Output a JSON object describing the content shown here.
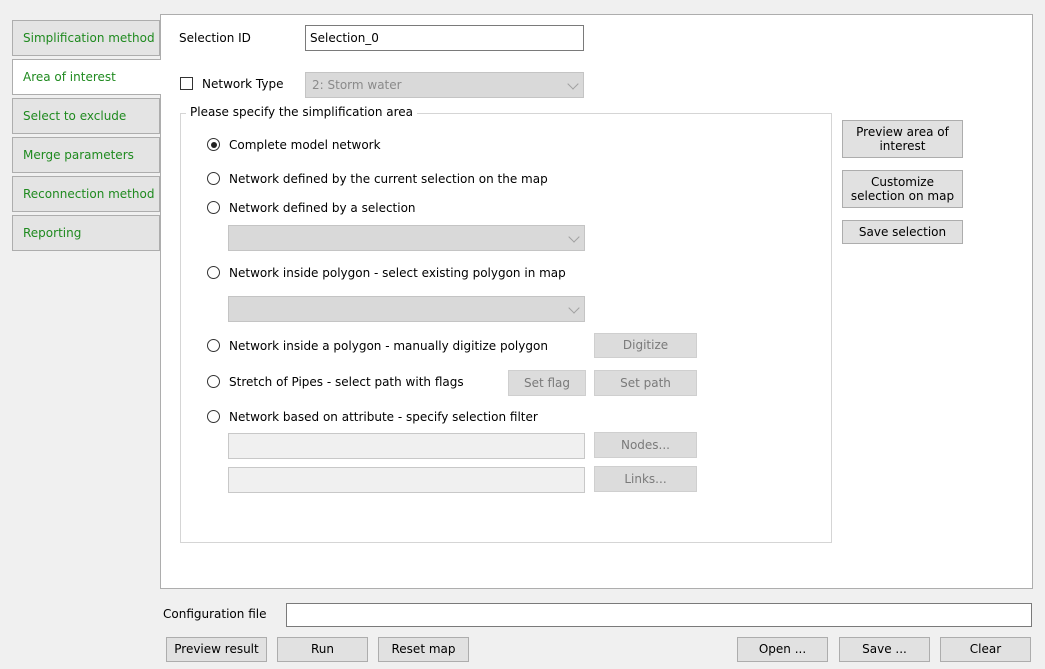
{
  "tabs": [
    {
      "label": "Simplification method",
      "active": false
    },
    {
      "label": "Area of interest",
      "active": true
    },
    {
      "label": "Select to exclude",
      "active": false
    },
    {
      "label": "Merge parameters",
      "active": false
    },
    {
      "label": "Reconnection method",
      "active": false
    },
    {
      "label": "Reporting",
      "active": false
    }
  ],
  "selection_id": {
    "label": "Selection ID",
    "value": "Selection_0"
  },
  "network_type": {
    "label": "Network Type",
    "checked": false,
    "value": "2: Storm water"
  },
  "group_title": "Please specify the simplification area",
  "options": [
    {
      "label": "Complete model network",
      "selected": true
    },
    {
      "label": "Network defined by the current selection on the map",
      "selected": false
    },
    {
      "label": "Network defined by a selection",
      "selected": false
    },
    {
      "label": "Network inside polygon - select existing polygon in map",
      "selected": false
    },
    {
      "label": "Network inside a polygon - manually digitize polygon",
      "selected": false
    },
    {
      "label": "Stretch of Pipes - select path with flags",
      "selected": false
    },
    {
      "label": "Network based on attribute - specify selection filter",
      "selected": false
    }
  ],
  "buttons": {
    "digitize": "Digitize",
    "set_flag": "Set flag",
    "set_path": "Set path",
    "nodes": "Nodes...",
    "links": "Links...",
    "preview_area": "Preview area of interest",
    "customize": "Customize selection on map",
    "save_selection": "Save selection",
    "preview_result": "Preview result",
    "run": "Run",
    "reset_map": "Reset map",
    "open": "Open ...",
    "save": "Save ...",
    "clear": "Clear"
  },
  "config_file": {
    "label": "Configuration file",
    "value": ""
  },
  "colors": {
    "tab_text": "#1f8a1f",
    "panel_bg": "#ffffff",
    "window_bg": "#f0f0f0"
  }
}
